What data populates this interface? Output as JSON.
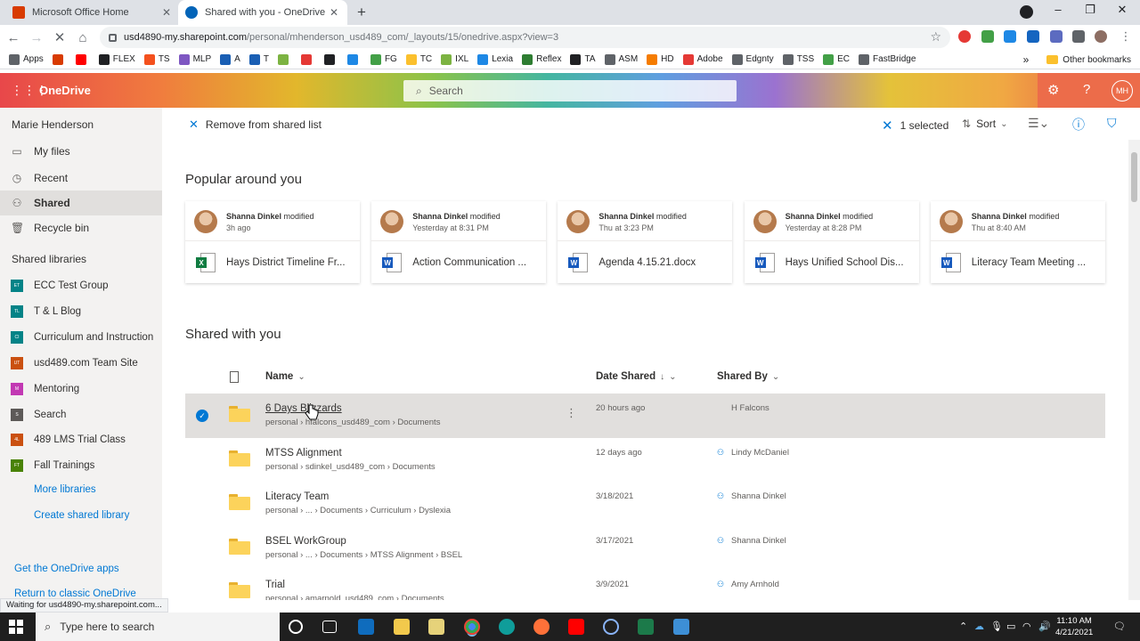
{
  "browser": {
    "tabs": [
      {
        "label": "Microsoft Office Home"
      },
      {
        "label": "Shared with you - OneDrive"
      }
    ],
    "new_tab": "+",
    "url_host": "usd4890-my.sharepoint.com",
    "url_path": "/personal/mhenderson_usd489_com/_layouts/15/onedrive.aspx?view=3",
    "bookmarks": [
      {
        "label": "Apps",
        "color": "#5f6368"
      },
      {
        "label": "",
        "color": "#d83b01"
      },
      {
        "label": "",
        "color": "#ff0000"
      },
      {
        "label": "FLEX",
        "color": "#202124"
      },
      {
        "label": "TS",
        "color": "#f4511e"
      },
      {
        "label": "MLP",
        "color": "#7e57c2"
      },
      {
        "label": "A",
        "color": "#1a5fb4"
      },
      {
        "label": "T",
        "color": "#1a5fb4"
      },
      {
        "label": "",
        "color": "#7cb342"
      },
      {
        "label": "",
        "color": "#e53935"
      },
      {
        "label": "",
        "color": "#202124"
      },
      {
        "label": "",
        "color": "#1e88e5"
      },
      {
        "label": "FG",
        "color": "#43a047"
      },
      {
        "label": "TC",
        "color": "#fbc02d"
      },
      {
        "label": "IXL",
        "color": "#7cb342"
      },
      {
        "label": "Lexia",
        "color": "#1e88e5"
      },
      {
        "label": "Reflex",
        "color": "#2e7d32"
      },
      {
        "label": "TA",
        "color": "#202124"
      },
      {
        "label": "ASM",
        "color": "#5f6368"
      },
      {
        "label": "HD",
        "color": "#f57c00"
      },
      {
        "label": "Adobe",
        "color": "#e53935"
      },
      {
        "label": "Edgnty",
        "color": "#5f6368"
      },
      {
        "label": "TSS",
        "color": "#5f6368"
      },
      {
        "label": "EC",
        "color": "#43a047"
      },
      {
        "label": "FastBridge",
        "color": "#5f6368"
      }
    ],
    "bookmarks_overflow": "»",
    "other_bookmarks": "Other bookmarks",
    "status": "Waiting for usd4890-my.sharepoint.com..."
  },
  "header": {
    "app_name": "OneDrive",
    "search_placeholder": "Search",
    "avatar_initials": "MH"
  },
  "sidebar": {
    "user_name": "Marie Henderson",
    "items": [
      {
        "label": "My files",
        "icon": "folder-icon"
      },
      {
        "label": "Recent",
        "icon": "clock-icon"
      },
      {
        "label": "Shared",
        "icon": "people-icon"
      },
      {
        "label": "Recycle bin",
        "icon": "trash-icon"
      }
    ],
    "libraries_heading": "Shared libraries",
    "libraries": [
      {
        "label": "ECC Test Group",
        "color": "#038387",
        "abbr": "ET"
      },
      {
        "label": "T & L Blog",
        "color": "#038387",
        "abbr": "TL"
      },
      {
        "label": "Curriculum and Instruction",
        "color": "#038387",
        "abbr": "CI"
      },
      {
        "label": "usd489.com Team Site",
        "color": "#ca5010",
        "abbr": "UT"
      },
      {
        "label": "Mentoring",
        "color": "#c239b3",
        "abbr": "M"
      },
      {
        "label": "Search",
        "color": "#5d5a58",
        "abbr": "S"
      },
      {
        "label": "489 LMS Trial Class",
        "color": "#ca5010",
        "abbr": "4L"
      },
      {
        "label": "Fall Trainings",
        "color": "#498205",
        "abbr": "FT"
      }
    ],
    "more_libraries": "More libraries",
    "create_library": "Create shared library",
    "get_apps": "Get the OneDrive apps",
    "return_classic": "Return to classic OneDrive"
  },
  "commandbar": {
    "remove_label": "Remove from shared list",
    "selected_label": "1 selected",
    "sort_label": "Sort"
  },
  "popular": {
    "heading": "Popular around you",
    "cards": [
      {
        "person": "Shanna Dinkel",
        "action": "modified",
        "time": "3h ago",
        "file": "Hays District Timeline Fr...",
        "type": "excel"
      },
      {
        "person": "Shanna Dinkel",
        "action": "modified",
        "time": "Yesterday at 8:31 PM",
        "file": "Action Communication ...",
        "type": "word"
      },
      {
        "person": "Shanna Dinkel",
        "action": "modified",
        "time": "Thu at 3:23 PM",
        "file": "Agenda 4.15.21.docx",
        "type": "word"
      },
      {
        "person": "Shanna Dinkel",
        "action": "modified",
        "time": "Yesterday at 8:28 PM",
        "file": "Hays Unified School Dis...",
        "type": "word"
      },
      {
        "person": "Shanna Dinkel",
        "action": "modified",
        "time": "Thu at 8:40 AM",
        "file": "Literacy Team Meeting ...",
        "type": "word"
      }
    ]
  },
  "shared": {
    "heading": "Shared with you",
    "columns": {
      "name": "Name",
      "date": "Date Shared",
      "sort_arrow": "↓",
      "by": "Shared By"
    },
    "rows": [
      {
        "name": "6 Days Blizzards",
        "path": "personal › hfalcons_usd489_com › Documents",
        "date": "20 hours ago",
        "by": "H Falcons",
        "selected": true
      },
      {
        "name": "MTSS Alignment",
        "path": "personal › sdinkel_usd489_com › Documents",
        "date": "12 days ago",
        "by": "Lindy McDaniel",
        "selected": false
      },
      {
        "name": "Literacy Team",
        "path": "personal › ... › Documents › Curriculum › Dyslexia",
        "date": "3/18/2021",
        "by": "Shanna Dinkel",
        "selected": false
      },
      {
        "name": "BSEL WorkGroup",
        "path": "personal › ... › Documents › MTSS Alignment › BSEL",
        "date": "3/17/2021",
        "by": "Shanna Dinkel",
        "selected": false
      },
      {
        "name": "Trial",
        "path": "personal › amarnold_usd489_com › Documents",
        "date": "3/9/2021",
        "by": "Amy Arnhold",
        "selected": false
      }
    ]
  },
  "taskbar": {
    "search_placeholder": "Type here to search",
    "time": "11:10 AM",
    "date": "4/21/2021"
  }
}
